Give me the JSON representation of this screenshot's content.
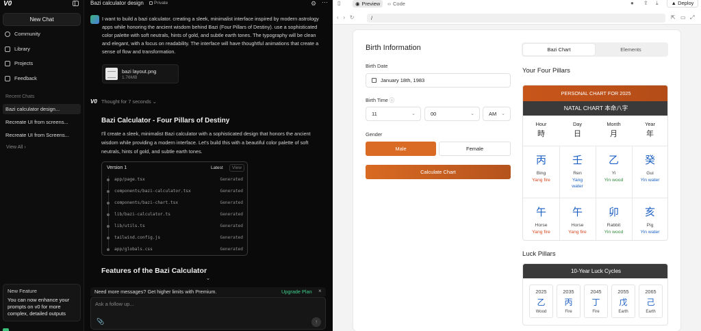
{
  "sidebar": {
    "logo": "V0",
    "new_chat": "New Chat",
    "nav": [
      {
        "label": "Community",
        "icon": "community-icon"
      },
      {
        "label": "Library",
        "icon": "library-icon"
      },
      {
        "label": "Projects",
        "icon": "projects-icon"
      },
      {
        "label": "Feedback",
        "icon": "feedback-icon"
      }
    ],
    "recent_heading": "Recent Chats",
    "recent": [
      "Bazi calculator design...",
      "Recreate UI from screens...",
      "Recreate UI from Screens..."
    ],
    "view_all": "View All",
    "new_feature": {
      "heading": "New Feature",
      "body": "You can now enhance your prompts on v0 for more complex, detailed outputs"
    }
  },
  "chat": {
    "title": "Bazi calculator design",
    "visibility": "Private",
    "user_message": "I want to build a bazi calculator. creating a sleek, minimalist interface inspired by modern astrology apps while honoring the ancient wisdom behind Bazi (Four Pillars of Destiny). use a sophisticated color palette with soft neutrals, hints of gold, and subtle earth tones. The typography will be clean and elegant, with a focus on readability. The interface will have thoughtful animations that create a sense of flow and transformation.",
    "attachment": {
      "name": "bazi layout.png",
      "size": "1.76MB"
    },
    "thought": "Thought for 7 seconds",
    "answer_heading": "Bazi Calculator - Four Pillars of Destiny",
    "answer_body": "I'll create a sleek, minimalist Bazi calculator with a sophisticated design that honors the ancient wisdom while providing a modern interface. Let's build this with a beautiful color palette of soft neutrals, hints of gold, and subtle earth tones.",
    "version": {
      "title": "Version 1",
      "latest": "Latest",
      "view": "View",
      "files": [
        {
          "name": "app/page.tsx",
          "status": "Generated"
        },
        {
          "name": "components/bazi-calculator.tsx",
          "status": "Generated"
        },
        {
          "name": "components/bazi-chart.tsx",
          "status": "Generated"
        },
        {
          "name": "lib/bazi-calculator.ts",
          "status": "Generated"
        },
        {
          "name": "lib/utils.ts",
          "status": "Generated"
        },
        {
          "name": "tailwind.config.js",
          "status": "Generated"
        },
        {
          "name": "app/globals.css",
          "status": "Generated"
        }
      ]
    },
    "features_heading": "Features of the Bazi Calculator",
    "upgrade_msg": "Need more messages? Get higher limits with Premium.",
    "upgrade_link": "Upgrade Plan",
    "input_placeholder": "Ask a follow up..."
  },
  "preview": {
    "tabs": [
      "Preview",
      "Code"
    ],
    "deploy": "Deploy",
    "url": "/",
    "form": {
      "title": "Birth Information",
      "date_label": "Birth Date",
      "date_value": "January 18th, 1983",
      "time_label": "Birth Time",
      "hour": "11",
      "minute": "00",
      "ampm": "AM",
      "gender_label": "Gender",
      "male": "Male",
      "female": "Female",
      "calculate": "Calculate Chart"
    },
    "chart": {
      "tabs": [
        "Bazi Chart",
        "Elements"
      ],
      "pillars_heading": "Your Four Pillars",
      "band_top": "PERSONAL CHART FOR 2025",
      "band_natal": "NATAL CHART 本命八字",
      "columns": [
        {
          "en": "Hour",
          "zh": "時"
        },
        {
          "en": "Day",
          "zh": "日"
        },
        {
          "en": "Month",
          "zh": "月"
        },
        {
          "en": "Year",
          "zh": "年"
        }
      ],
      "stems": [
        {
          "char": "丙",
          "pinyin": "Bing",
          "element": "Yang fire",
          "color": "#d9451c"
        },
        {
          "char": "壬",
          "pinyin": "Ren",
          "element": "Yang water",
          "color": "#1b5fc4"
        },
        {
          "char": "乙",
          "pinyin": "Yi",
          "element": "Yin wood",
          "color": "#2e8b3a"
        },
        {
          "char": "癸",
          "pinyin": "Gui",
          "element": "Yin water",
          "color": "#1b5fc4"
        }
      ],
      "branches": [
        {
          "char": "午",
          "pinyin": "Horse",
          "element": "Yang fire",
          "color": "#d9451c"
        },
        {
          "char": "午",
          "pinyin": "Horse",
          "element": "Yang fire",
          "color": "#d9451c"
        },
        {
          "char": "卯",
          "pinyin": "Rabbit",
          "element": "Yin wood",
          "color": "#2e8b3a"
        },
        {
          "char": "亥",
          "pinyin": "Pig",
          "element": "Yin water",
          "color": "#1b5fc4"
        }
      ],
      "luck_heading": "Luck Pillars",
      "luck_band": "10-Year Luck Cycles",
      "luck": [
        {
          "year": "2025",
          "char": "乙",
          "element": "Wood"
        },
        {
          "year": "2035",
          "char": "丙",
          "element": "Fire"
        },
        {
          "year": "2045",
          "char": "丁",
          "element": "Fire"
        },
        {
          "year": "2055",
          "char": "戊",
          "element": "Earth"
        },
        {
          "year": "2065",
          "char": "己",
          "element": "Earth"
        }
      ]
    }
  }
}
